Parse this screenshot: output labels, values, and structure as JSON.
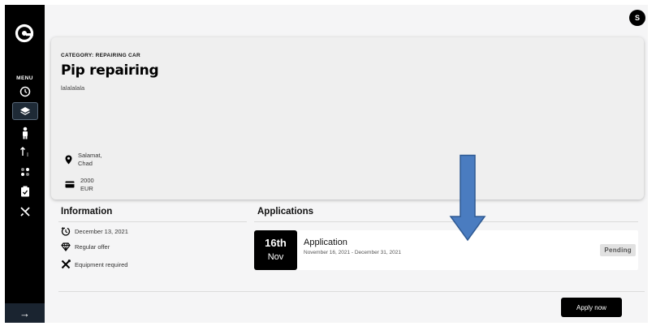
{
  "app": {
    "avatar_initial": "S",
    "menu_label": "MENU",
    "collapse_arrow": "→"
  },
  "sidebar": {
    "items": [
      {
        "icon": "clock-icon"
      },
      {
        "icon": "layers-icon",
        "active": true
      },
      {
        "icon": "person-icon"
      },
      {
        "icon": "sort-icon"
      },
      {
        "icon": "dots-icon"
      },
      {
        "icon": "clipboard-check-icon"
      },
      {
        "icon": "tools-icon"
      }
    ]
  },
  "offer": {
    "category": "CATEGORY: REPAIRING CAR",
    "title": "Pip repairing",
    "description": "lalalalala",
    "location_line1": "Salamat,",
    "location_line2": "Chad",
    "price_amount": "2000",
    "price_currency": "EUR"
  },
  "information": {
    "heading": "Information",
    "date": "December 13, 2021",
    "offer_type": "Regular offer",
    "equipment": "Equipment required"
  },
  "applications": {
    "heading": "Applications",
    "items": [
      {
        "day": "16th",
        "month": "Nov",
        "title": "Application",
        "date_range": "November 16, 2021 - December 31, 2021",
        "status": "Pending"
      }
    ]
  },
  "actions": {
    "apply_label": "Apply now"
  },
  "colors": {
    "sidebar": "#000000",
    "background": "#f5f5f6",
    "card": "#efefef",
    "annotation_arrow": "#4a7cc0"
  }
}
